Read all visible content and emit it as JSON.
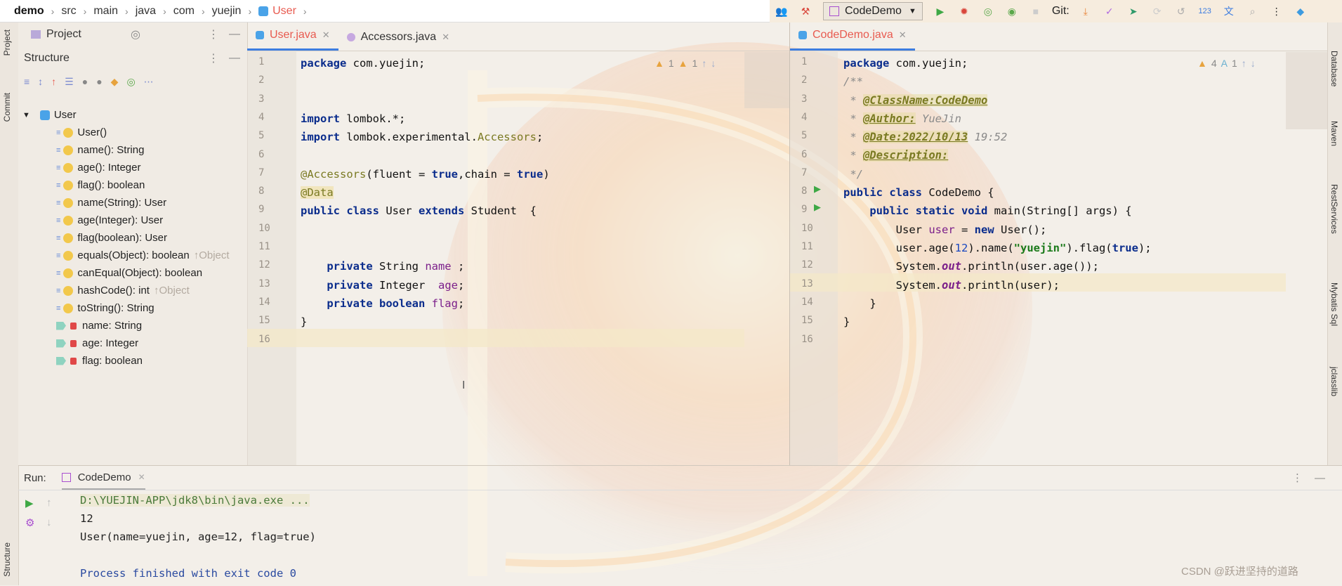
{
  "breadcrumb": {
    "items": [
      "demo",
      "src",
      "main",
      "java",
      "com",
      "yuejin",
      "User"
    ]
  },
  "toolbar": {
    "run_config": "CodeDemo",
    "git_label": "Git:",
    "misc_number": "123"
  },
  "left_strip": {
    "project": "Project",
    "commit": "Commit",
    "structure": "Structure"
  },
  "right_strip": {
    "items": [
      "Database",
      "Maven",
      "RestServices",
      "Mybatis Sql",
      "jclasslib"
    ]
  },
  "project_panel": {
    "title": "Project"
  },
  "structure_panel": {
    "title": "Structure",
    "root": "User",
    "members": [
      {
        "label": "User()",
        "suffix": ""
      },
      {
        "label": "name(): String",
        "suffix": ""
      },
      {
        "label": "age(): Integer",
        "suffix": ""
      },
      {
        "label": "flag(): boolean",
        "suffix": ""
      },
      {
        "label": "name(String): User",
        "suffix": ""
      },
      {
        "label": "age(Integer): User",
        "suffix": ""
      },
      {
        "label": "flag(boolean): User",
        "suffix": ""
      },
      {
        "label": "equals(Object): boolean",
        "suffix": "↑Object"
      },
      {
        "label": "canEqual(Object): boolean",
        "suffix": ""
      },
      {
        "label": "hashCode(): int",
        "suffix": "↑Object"
      },
      {
        "label": "toString(): String",
        "suffix": ""
      }
    ],
    "fields": [
      {
        "label": "name: String"
      },
      {
        "label": "age: Integer"
      },
      {
        "label": "flag: boolean"
      }
    ]
  },
  "editor_left": {
    "tabs": [
      {
        "label": "User.java",
        "active": true
      },
      {
        "label": "Accessors.java",
        "active": false
      }
    ],
    "warnings": "1",
    "weak_warnings": "1",
    "line_numbers": [
      "1",
      "2",
      "3",
      "4",
      "5",
      "6",
      "7",
      "8",
      "9",
      "10",
      "11",
      "12",
      "13",
      "14",
      "15",
      "16"
    ],
    "code": {
      "l1a": "package",
      "l1b": " com.yuejin;",
      "l4a": "import",
      "l4b": " lombok.*;",
      "l5a": "import",
      "l5b": " lombok.experimental.",
      "l5c": "Accessors",
      ";": ";",
      "l7a": "@Accessors",
      "l7b": "(fluent = ",
      "l7c": "true",
      "l7d": ",chain = ",
      "l7e": "true",
      "l7f": ")",
      "l8": "@Data",
      "l9a": "public class",
      "l9b": " User ",
      "l9c": "extends",
      "l9d": " Student  {",
      "l12a": "private",
      "l12b": " String ",
      "l12c": "name",
      "l12d": " ;",
      "l13a": "private",
      "l13b": " Integer  ",
      "l13c": "age",
      "l14a": "private boolean",
      "l14b": " flag",
      "l15": "}"
    }
  },
  "editor_right": {
    "tabs": [
      {
        "label": "CodeDemo.java",
        "active": true
      }
    ],
    "warnings": "4",
    "typos": "1",
    "line_numbers": [
      "1",
      "2",
      "3",
      "4",
      "5",
      "6",
      "7",
      "8",
      "9",
      "10",
      "11",
      "12",
      "13",
      "14",
      "15",
      "16"
    ],
    "code": {
      "l1a": "package",
      "l1b": " com.yuejin;",
      "l2": "/**",
      "l3a": " * ",
      "l3b": "@ClassName:CodeDemo",
      "l4a": " * ",
      "l4b": "@Author:",
      "l4c": " YueJin",
      "l5a": " * ",
      "l5b": "@Date:2022/10/13",
      "l5c": " 19:52",
      "l6a": " * ",
      "l6b": "@Description:",
      "l7": " */",
      "l8a": "public class",
      "l8b": " CodeDemo {",
      "l9a": "public static void",
      "l9b": " main(String[] args) {",
      "l10a": "User ",
      "l10b": "user",
      "l10c": " = ",
      "l10d": "new",
      "l10e": " User();",
      "l11a": "user",
      "l11b": ".age(",
      "l11c": "12",
      "l11d": ").name(",
      "l11e": "\"yuejin\"",
      "l11f": ").flag(",
      "l11g": "true",
      "l11h": ");",
      "l12a": "System.",
      "l12b": "out",
      "l12c": ".println(",
      "l12d": "user",
      "l12e": ".age());",
      "l13a": "System.",
      "l13b": "out",
      "l13c": ".println(",
      "l13d": "user",
      "l13e": ");",
      "l14": "}",
      "l15": "}"
    }
  },
  "run_panel": {
    "label": "Run:",
    "tab": "CodeDemo",
    "output": [
      "D:\\YUEJIN-APP\\jdk8\\bin\\java.exe ...",
      "12",
      "User(name=yuejin, age=12, flag=true)",
      "",
      "Process finished with exit code 0"
    ]
  },
  "watermark": "CSDN @跃进坚持的道路",
  "colors": {
    "accent": "#3d7de0",
    "active_tab_text": "#e85a4f",
    "keyword": "#0a2c8c",
    "string": "#1a7a1a",
    "field": "#7b1f8a",
    "annotation": "#7a7a22"
  }
}
